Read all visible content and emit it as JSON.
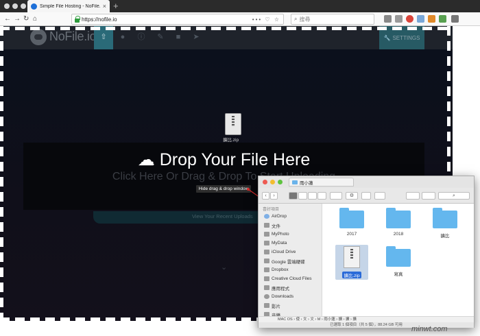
{
  "browser": {
    "tab_title": "Simple File Hosting - NoFile.io",
    "tab_close": "×",
    "new_tab": "+",
    "url": "https://nofile.io",
    "url_tools": "••• ♡ ☆",
    "search_placeholder": "搜尋",
    "back": "←",
    "forward": "→",
    "reload": "↻",
    "home": "⌂"
  },
  "site": {
    "logo_text": "NoFile.io",
    "settings_label": "SETTINGS",
    "drop_title": "Drop Your File Here",
    "drop_subtitle": "Click Here Or Drag & Drop To Start Uploading",
    "tooltip": "Hide drag & drop window",
    "recent_uploads": "View Your Recent Uploads",
    "chevron": "⌄"
  },
  "dragged_file": {
    "name": "擴比.zip"
  },
  "finder": {
    "tab_title": "雨小蓮",
    "sidebar_header": "喜好項目",
    "sidebar": [
      {
        "label": "AirDrop"
      },
      {
        "label": "文件"
      },
      {
        "label": "MyPhoto"
      },
      {
        "label": "MyData"
      },
      {
        "label": "iCloud Drive"
      },
      {
        "label": "Google 雲端硬碟"
      },
      {
        "label": "Dropbox"
      },
      {
        "label": "Creative Cloud Files"
      },
      {
        "label": "應用程式"
      },
      {
        "label": "Downloads"
      },
      {
        "label": "影片"
      },
      {
        "label": "音樂"
      }
    ],
    "items": [
      {
        "label": "2017"
      },
      {
        "label": "2018"
      },
      {
        "label": "擴比"
      },
      {
        "label": "擴比.zip"
      },
      {
        "label": "寫真"
      }
    ],
    "path": "MAC OS  ›  使  ›  文  ›  文  ›  M  ›  雨小蓮  ›  擴  ›  擴  ›  擴",
    "status": "已選取 1 個項目（共 5 個），88.24 GB 可用"
  },
  "watermark": "minwt.com"
}
